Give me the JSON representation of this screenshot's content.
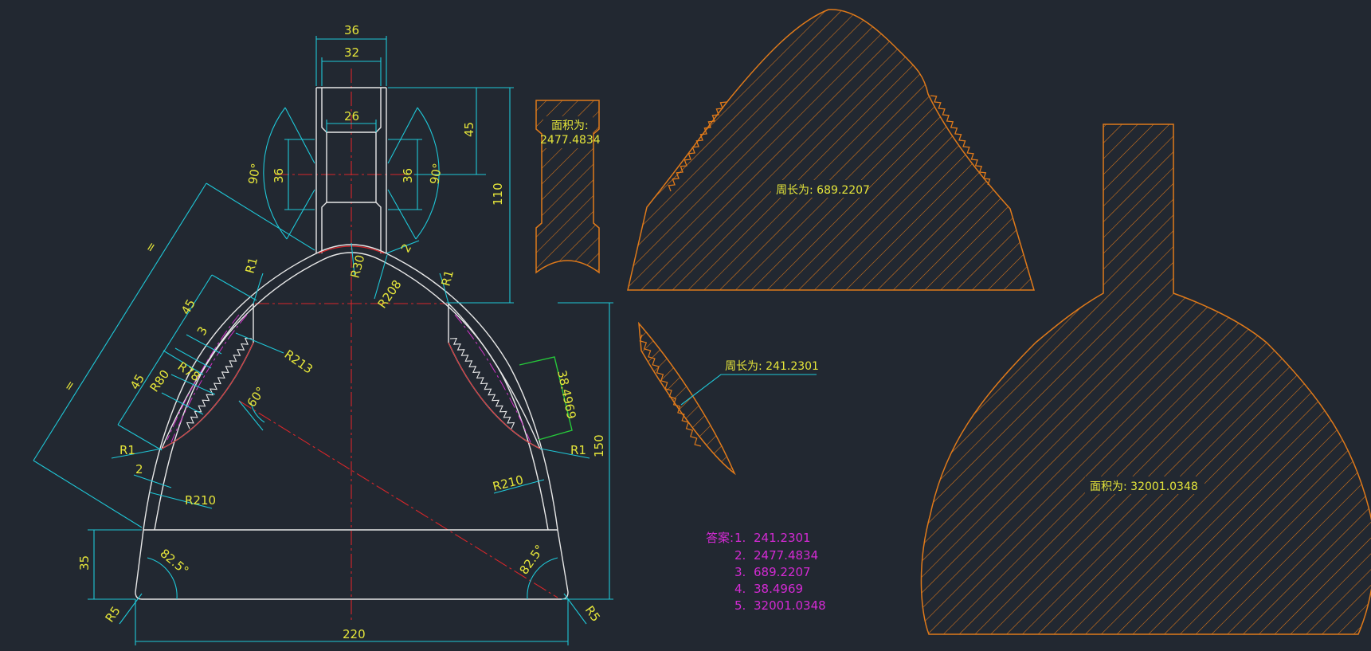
{
  "colors": {
    "background": "#222831",
    "outline": "#e8e8e8",
    "dimension": "#1fc8d8",
    "dimension_text": "#e6e63a",
    "centerline": "#d8262a",
    "hatch": "#e07a1a",
    "answer": "#d42ad4",
    "measure": "#26c83a"
  },
  "dims": {
    "w36": "36",
    "w32": "32",
    "w26": "26",
    "h45": "45",
    "h110": "110",
    "neck_left_36": "36",
    "neck_right_36": "36",
    "ang90_left": "90°",
    "ang90_right": "90°",
    "eq_outer": "=",
    "eq_inner": "=",
    "d45_top": "45",
    "d45_bottom": "45",
    "d3": "3",
    "r1_top_left": "R1",
    "r1_top_right": "R1",
    "r1_mid_left": "R1",
    "r1_mid_right": "R1",
    "r30": "R30",
    "d2_top": "2",
    "r208": "R208",
    "r213": "R213",
    "r78": "R78",
    "r80": "R80",
    "ang60": "60°",
    "d2_side": "2",
    "r210_left": "R210",
    "r210_right": "R210",
    "measure_38": "38.4969",
    "h150": "150",
    "h35": "35",
    "ang82_left": "82.5°",
    "ang82_right": "82.5°",
    "r5_left": "R5",
    "r5_right": "R5",
    "w220": "220"
  },
  "labels": {
    "area_small_line1": "面积为:",
    "area_small_line2": "2477.4834",
    "perimeter_top": "周长为: 689.2207",
    "perimeter_small": "周长为: 241.2301",
    "area_large": "面积为: 32001.0348"
  },
  "answers": {
    "title": "答案:",
    "items": [
      {
        "num": "1.",
        "value": "241.2301"
      },
      {
        "num": "2.",
        "value": "2477.4834"
      },
      {
        "num": "3.",
        "value": "689.2207"
      },
      {
        "num": "4.",
        "value": "38.4969"
      },
      {
        "num": "5.",
        "value": "32001.0348"
      }
    ]
  }
}
